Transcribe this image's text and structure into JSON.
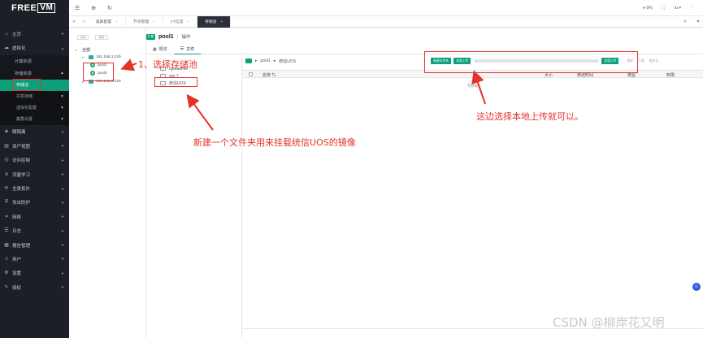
{
  "app": {
    "logo_main": "FREE",
    "logo_box": "VM"
  },
  "sidebar": {
    "items": [
      {
        "label": "主页",
        "icon": "home-icon",
        "glyph": "⌂",
        "expanded": false
      },
      {
        "label": "虚拟化",
        "icon": "cloud-icon",
        "glyph": "☁",
        "expanded": true
      },
      {
        "label": "微隔离",
        "icon": "shield-icon",
        "glyph": "◈",
        "expanded": false
      },
      {
        "label": "资产视图",
        "icon": "asset-icon",
        "glyph": "▤",
        "expanded": false
      },
      {
        "label": "访问控制",
        "icon": "lock-icon",
        "glyph": "◎",
        "expanded": false
      },
      {
        "label": "流量学习",
        "icon": "flow-icon",
        "glyph": "≋",
        "expanded": false
      },
      {
        "label": "全景拓扑",
        "icon": "topology-icon",
        "glyph": "✣",
        "expanded": false
      },
      {
        "label": "攻击防护",
        "icon": "protect-icon",
        "glyph": "⛨",
        "expanded": false
      },
      {
        "label": "网络",
        "icon": "network-icon",
        "glyph": "⌗",
        "expanded": false
      },
      {
        "label": "日志",
        "icon": "log-icon",
        "glyph": "☰",
        "expanded": false
      },
      {
        "label": "报告管理",
        "icon": "report-icon",
        "glyph": "▦",
        "expanded": false
      },
      {
        "label": "用户",
        "icon": "user-icon",
        "glyph": "☺",
        "expanded": false
      },
      {
        "label": "设置",
        "icon": "gear-icon",
        "glyph": "⚙",
        "expanded": false
      },
      {
        "label": "授权",
        "icon": "license-icon",
        "glyph": "✎",
        "expanded": false
      }
    ],
    "virt_children": [
      {
        "label": "计算资源"
      },
      {
        "label": "存储资源",
        "expanded": true
      }
    ],
    "storage_children": [
      {
        "label": "存储池",
        "active": true
      },
      {
        "label": "共享存储"
      },
      {
        "label": "虚拟化配置"
      },
      {
        "label": "集群设置"
      }
    ]
  },
  "topbar": {
    "right_user": "lu",
    "right_badge": "0%"
  },
  "tabs": [
    {
      "label": "集群配置",
      "active": false
    },
    {
      "label": "节点管理",
      "active": false
    },
    {
      "label": "VT信息",
      "active": false
    },
    {
      "label": "存储池",
      "active": true
    }
  ],
  "left_panel": {
    "btn1": "添加",
    "btn2": "刷新",
    "root_label": "全部",
    "hosts": [
      {
        "ip": "192.168.3.230",
        "pools": [
          "pool1",
          "pool2"
        ]
      },
      {
        "ip": "192.168.3.229",
        "pools": []
      }
    ]
  },
  "pool_header": {
    "tag": "扩展",
    "name": "pool1",
    "ops": "操作"
  },
  "subtabs": [
    {
      "label": "概览",
      "icon": "overview-icon",
      "active": false
    },
    {
      "label": "文件",
      "icon": "file-icon",
      "active": true
    }
  ],
  "folders": [
    "uploadFile",
    "win 7",
    "统信UOS"
  ],
  "file_panel": {
    "breadcrumb": [
      "pool1",
      "统信UOS"
    ],
    "new_folder_btn": "新建文件夹",
    "local_upload_btn": "本地上传",
    "remote_upload_btn": "远程上传",
    "right_actions": [
      "删除",
      "下载",
      "重命名"
    ],
    "upload_progress": 0.02,
    "columns": [
      "名称",
      "大小",
      "修改时间",
      "类型",
      "权限"
    ],
    "empty_text": "无数据"
  },
  "annotations": {
    "a1": "1、选择存储池",
    "a2": "新建一个文件夹用来挂载统信UOS的镜像",
    "a3": "这边选择本地上传就可以。"
  },
  "watermark": "CSDN @柳岸花又明",
  "colors": {
    "accent": "#0e9e7a",
    "annotation": "#e4322b",
    "sidebar_bg": "#1c1f26"
  }
}
